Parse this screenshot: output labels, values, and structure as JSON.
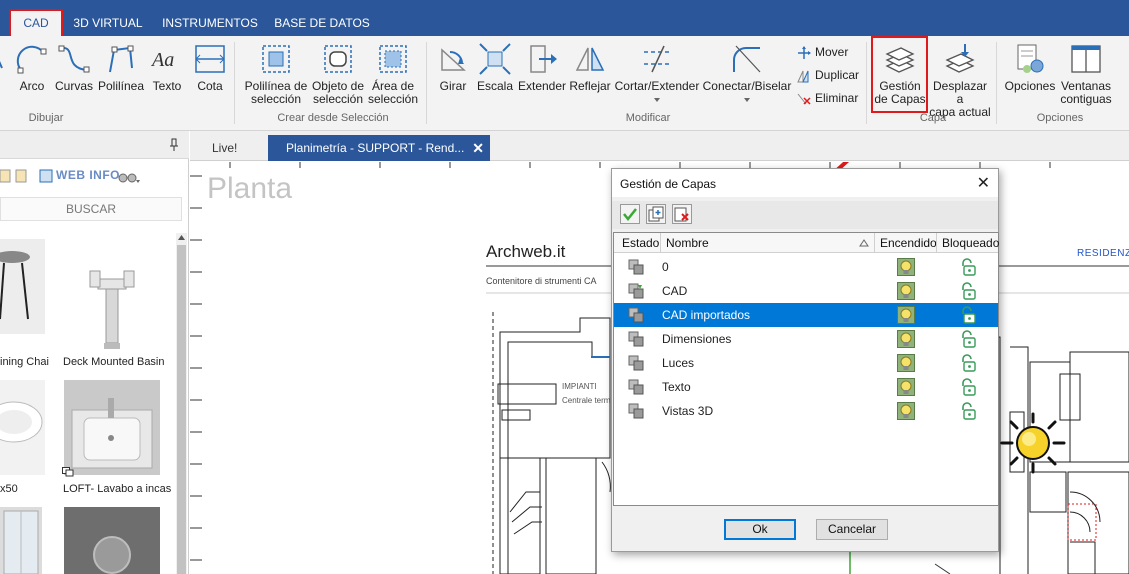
{
  "ribbon_tabs": [
    {
      "label": "CAD"
    },
    {
      "label": "3D VIRTUAL"
    },
    {
      "label": "INSTRUMENTOS"
    },
    {
      "label": "BASE DE DATOS"
    }
  ],
  "ribbon": {
    "dibujar": {
      "arco": "Arco",
      "curvas": "Curvas",
      "polilinea": "Polilínea",
      "texto": "Texto",
      "cota": "Cota",
      "group_label": "Dibujar"
    },
    "seleccion": {
      "polilinea_sel_1": "Polilínea de",
      "polilinea_sel_2": "selección",
      "objeto_sel_1": "Objeto de",
      "objeto_sel_2": "selección",
      "area_sel_1": "Área de",
      "area_sel_2": "selección",
      "group_label": "Crear desde Selección"
    },
    "modificar": {
      "girar": "Girar",
      "escala": "Escala",
      "extender": "Extender",
      "reflejar": "Reflejar",
      "cortar": "Cortar/Extender",
      "conectar": "Conectar/Biselar",
      "mover": "Mover",
      "duplicar": "Duplicar",
      "eliminar": "Eliminar",
      "group_label": "Modificar"
    },
    "capa": {
      "gestion_1": "Gestión",
      "gestion_2": "de Capas",
      "desplazar_1": "Desplazar a",
      "desplazar_2": "capa actual",
      "group_label": "Capa"
    },
    "opciones": {
      "opciones": "Opciones",
      "ventanas_1": "Ventanas",
      "ventanas_2": "contiguas",
      "group_label": "Opciones"
    }
  },
  "left_panel": {
    "webinfo": "WEB INFO",
    "search_label": "BUSCAR",
    "items": [
      {
        "label": "ining Chai"
      },
      {
        "label": "Deck Mounted Basin"
      },
      {
        "label": "x50"
      },
      {
        "label": "LOFT- Lavabo a incas"
      }
    ]
  },
  "doc_tabs": {
    "live": "Live!",
    "plan": "Planimetría - SUPPORT - Rend...",
    "close": "✕"
  },
  "canvas": {
    "title": "Planta",
    "archweb_title": "Archweb.it",
    "archweb_sub": "Contenitore di strumenti CA",
    "residenz": "RESIDENZ",
    "impianti": "IMPIANTI",
    "centrale": "Centrale termi"
  },
  "dialog": {
    "title": "Gestión de Capas",
    "close": "✕",
    "columns": {
      "estado": "Estado",
      "nombre": "Nombre",
      "encendido": "Encendido",
      "bloqueado": "Bloqueado"
    },
    "layers": [
      {
        "name": "0"
      },
      {
        "name": "CAD"
      },
      {
        "name": "CAD importados"
      },
      {
        "name": "Dimensiones"
      },
      {
        "name": "Luces"
      },
      {
        "name": "Texto"
      },
      {
        "name": "Vistas 3D"
      }
    ],
    "selected_layer": "CAD importados",
    "ok": "Ok",
    "cancel": "Cancelar"
  },
  "colors": {
    "accent_blue": "#2b579a",
    "selection_blue": "#0078d7",
    "highlight_red": "#e0191a"
  }
}
